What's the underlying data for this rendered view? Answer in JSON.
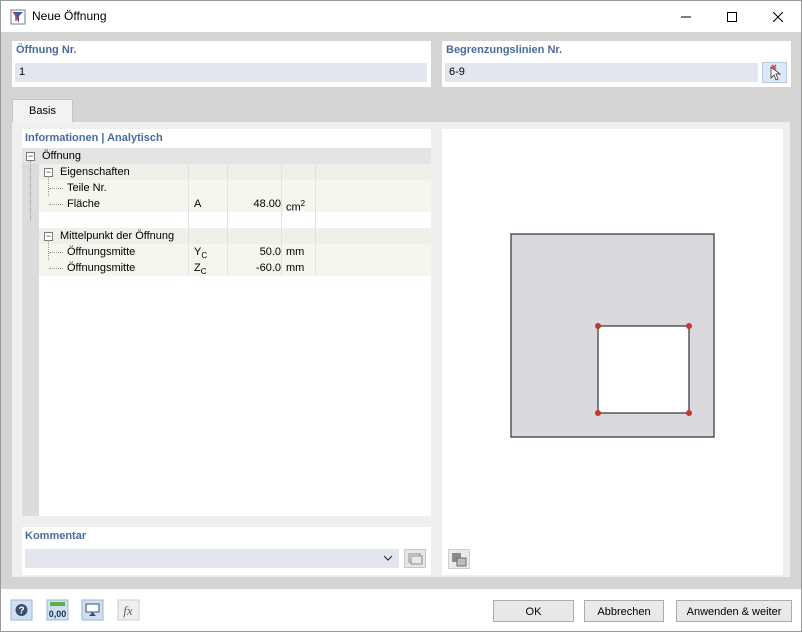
{
  "window": {
    "title": "Neue Öffnung",
    "minimize_icon": "minimize-icon",
    "maximize_icon": "maximize-icon",
    "close_icon": "close-icon"
  },
  "opening_no": {
    "label": "Öffnung Nr.",
    "value": "1"
  },
  "boundary_lines": {
    "label": "Begrenzungslinien Nr.",
    "value": "6-9",
    "pick_icon": "pick-lines-icon"
  },
  "tabs": [
    {
      "label": "Basis"
    }
  ],
  "info": {
    "header": "Informationen | Analytisch",
    "root": {
      "label": "Öffnung"
    },
    "groups": [
      {
        "label": "Eigenschaften",
        "rows": [
          {
            "label": "Teile Nr.",
            "symbol": "",
            "value": "",
            "unit": ""
          },
          {
            "label": "Fläche",
            "symbol": "A",
            "value": "48.00",
            "unit": "cm",
            "unit_sup": "2"
          }
        ]
      },
      {
        "label": "Mittelpunkt der Öffnung",
        "rows": [
          {
            "label": "Öffnungsmitte",
            "symbol": "Y",
            "symbol_sub": "C",
            "value": "50.0",
            "unit": "mm"
          },
          {
            "label": "Öffnungsmitte",
            "symbol": "Z",
            "symbol_sub": "C",
            "value": "-60.0",
            "unit": "mm"
          }
        ]
      }
    ]
  },
  "comment": {
    "label": "Kommentar",
    "value": "",
    "dropdown_icon": "chevron-down-icon",
    "library_icon": "library-icon"
  },
  "preview": {
    "settings_icon": "preview-settings-icon",
    "colors": {
      "outer_fill": "#d9d9de",
      "outline": "#4a4a55",
      "node": "#c0392b"
    }
  },
  "footer": {
    "icons": [
      "help-icon",
      "units-icon",
      "display-icon",
      "formula-icon"
    ],
    "units_icon_text": "0,00",
    "ok_label": "OK",
    "cancel_label": "Abbrechen",
    "apply_label": "Anwenden & weiter"
  }
}
